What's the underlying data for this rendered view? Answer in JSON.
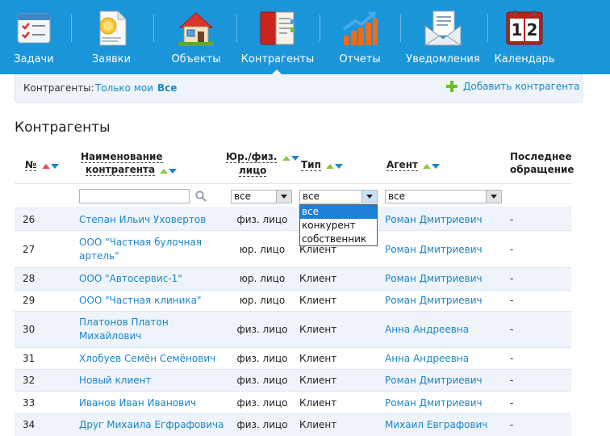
{
  "nav": [
    {
      "label": "Задачи",
      "icon": "tasks-checklist-icon"
    },
    {
      "label": "Заявки",
      "icon": "requests-document-icon"
    },
    {
      "label": "Объекты",
      "icon": "house-icon"
    },
    {
      "label": "Контрагенты",
      "icon": "address-book-icon"
    },
    {
      "label": "Отчеты",
      "icon": "bar-chart-icon"
    },
    {
      "label": "Уведомления",
      "icon": "envelope-icon"
    },
    {
      "label": "Календарь",
      "icon": "calendar-icon"
    }
  ],
  "calendar_icon_text": "1|2",
  "filterbar": {
    "label": "Контрагенты:",
    "mine": "Только мои",
    "all": "Все",
    "add": "Добавить контрагента"
  },
  "page_title": "Контрагенты",
  "columns": {
    "num": "№",
    "name_line1": "Наименование",
    "name_line2": "контрагента",
    "law_line1": "Юр./физ.",
    "law_line2": "лицо",
    "type": "Тип",
    "agent": "Агент",
    "last_line1": "Последнее",
    "last_line2": "обращение"
  },
  "filters": {
    "name_placeholder": "",
    "law_value": "все",
    "type_value": "все",
    "agent_value": "все"
  },
  "type_dropdown": [
    "все",
    "конкурент",
    "собственник"
  ],
  "rows": [
    {
      "num": "26",
      "name": "Степан Ильич Уховертов",
      "law": "физ. лицо",
      "type": "",
      "agent": "Роман Дмитриевич",
      "last": "-"
    },
    {
      "num": "27",
      "name": "ООО \"Частная булочная артель\"",
      "law": "юр. лицо",
      "type": "Клиент",
      "agent": "Роман Дмитриевич",
      "last": "-"
    },
    {
      "num": "28",
      "name": "ООО \"Автосервис-1\"",
      "law": "юр. лицо",
      "type": "Клиент",
      "agent": "Роман Дмитриевич",
      "last": "-"
    },
    {
      "num": "29",
      "name": "ООО \"Частная клиника\"",
      "law": "юр. лицо",
      "type": "Клиент",
      "agent": "Роман Дмитриевич",
      "last": "-"
    },
    {
      "num": "30",
      "name": "Платонов Платон Михайлович",
      "law": "физ. лицо",
      "type": "Клиент",
      "agent": "Анна Андреевна",
      "last": "-"
    },
    {
      "num": "31",
      "name": "Хлобуев Семён Семёнович",
      "law": "физ. лицо",
      "type": "Клиент",
      "agent": "Анна Андреевна",
      "last": "-"
    },
    {
      "num": "32",
      "name": "Новый клиент",
      "law": "физ. лицо",
      "type": "Клиент",
      "agent": "Роман Дмитриевич",
      "last": "-"
    },
    {
      "num": "33",
      "name": "Иванов Иван Иванович",
      "law": "физ. лицо",
      "type": "Клиент",
      "agent": "Роман Дмитриевич",
      "last": "-"
    },
    {
      "num": "34",
      "name": "Друг Михаила Егфрафовича",
      "law": "физ. лицо",
      "type": "Клиент",
      "agent": "Михаил Евграфович",
      "last": "-"
    }
  ],
  "colors": {
    "nav_bg": "#1b95d9",
    "link": "#1a85c8",
    "alt_row": "#eef4f9",
    "selected_option": "#1e7fd8"
  }
}
